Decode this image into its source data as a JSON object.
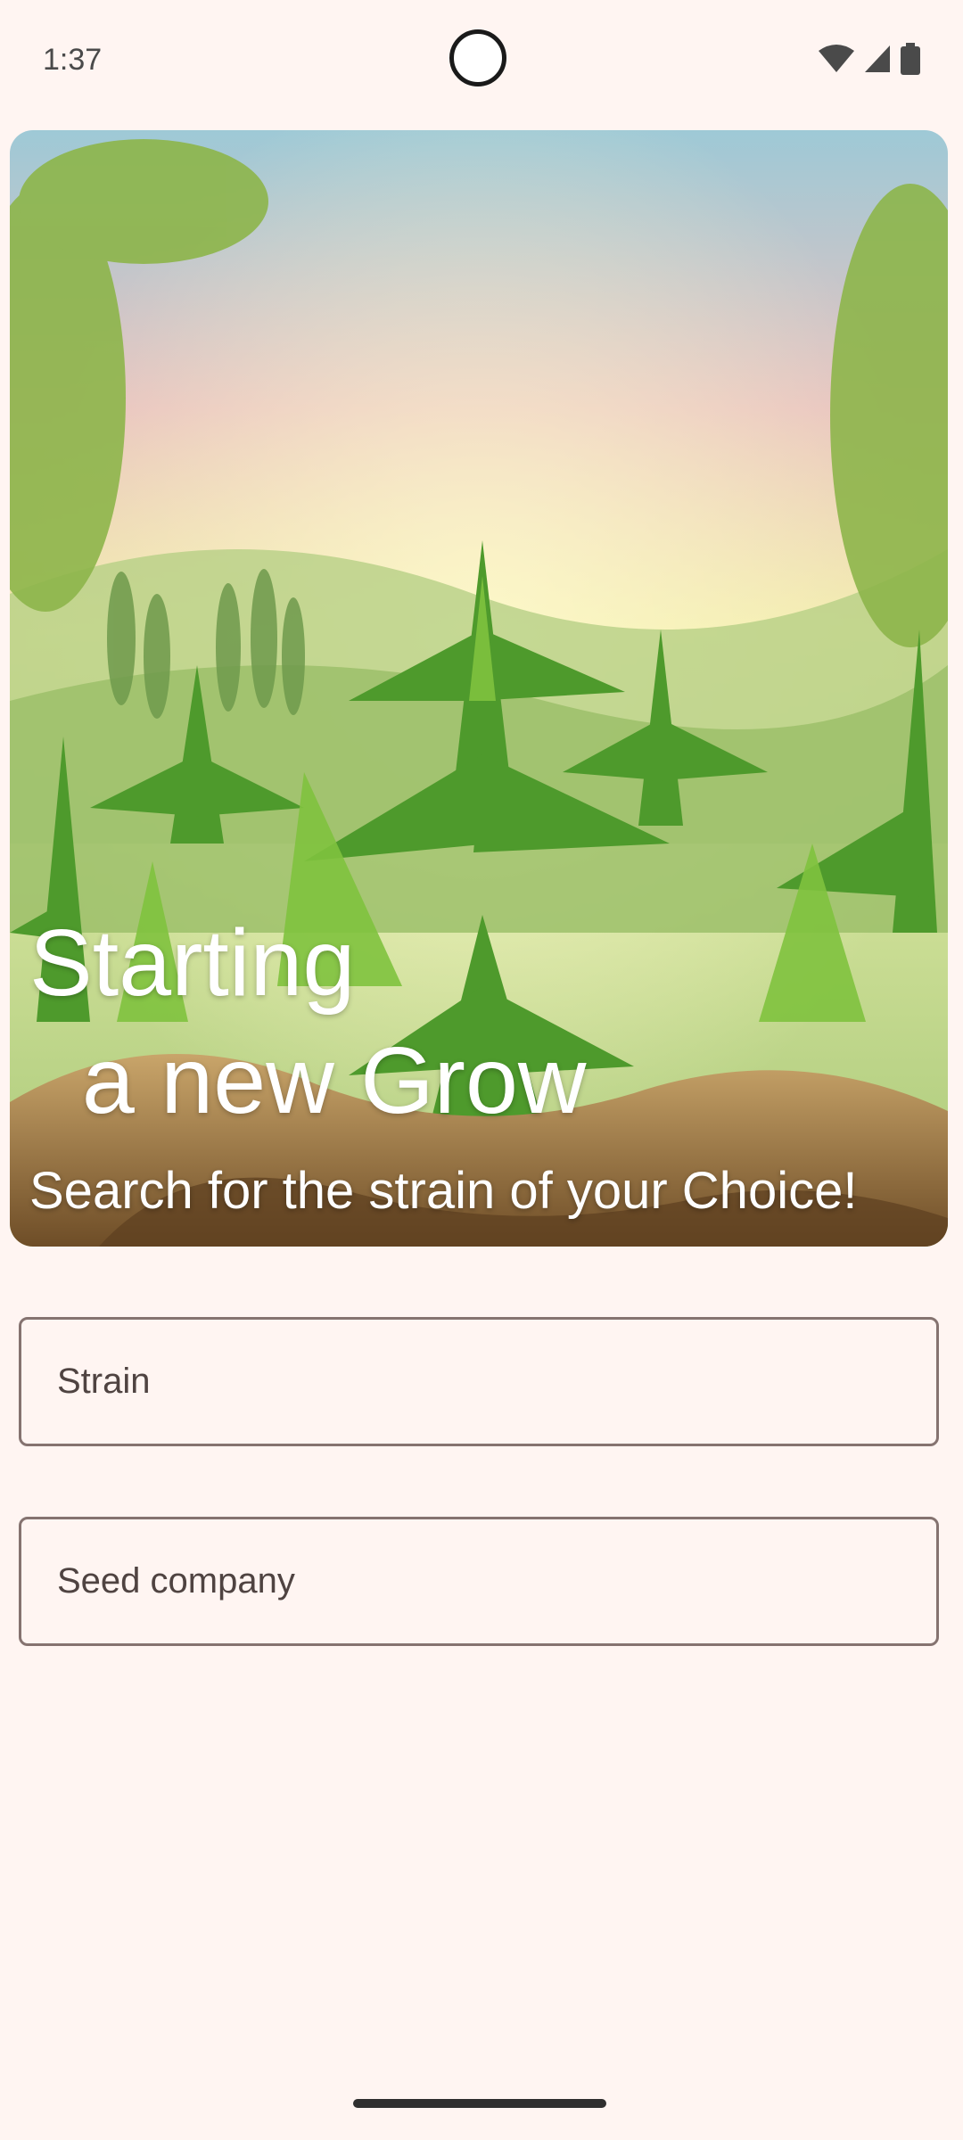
{
  "status_bar": {
    "time": "1:37",
    "icons": [
      "wifi-icon",
      "cellular-signal-icon",
      "battery-icon"
    ]
  },
  "hero": {
    "image": "cannabis-field-illustration",
    "title": "Starting\n  a new Grow",
    "subtitle": "Search for the strain of your Choice!"
  },
  "form": {
    "strain": {
      "placeholder": "Strain",
      "value": ""
    },
    "seed_company": {
      "placeholder": "Seed company",
      "value": ""
    }
  },
  "colors": {
    "background": "#fff5f2",
    "field_border": "#857370",
    "text": "#4f4341"
  }
}
